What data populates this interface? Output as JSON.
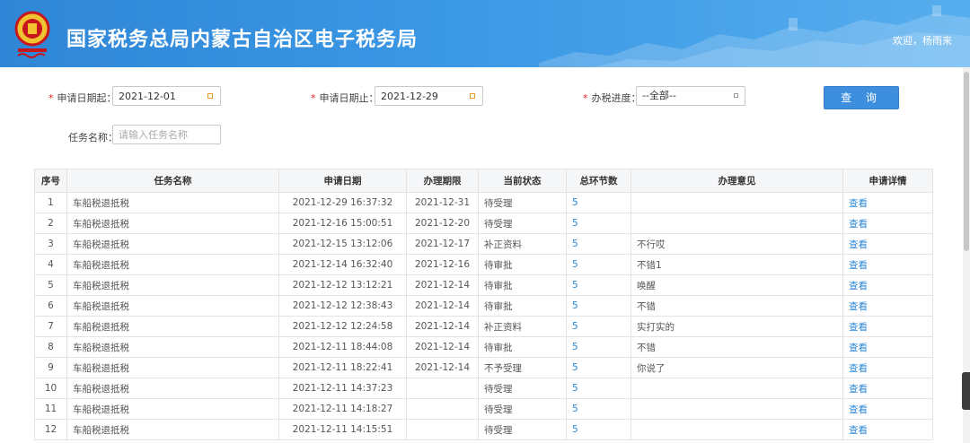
{
  "header": {
    "title": "国家税务总局内蒙古自治区电子税务局",
    "welcome": "欢迎，杨雨来",
    "logo_icon": "tax-emblem-icon",
    "colors": {
      "bar": "#3a97e4"
    }
  },
  "form": {
    "start_date_label": "申请日期起：",
    "start_date_value": "2021-12-01",
    "end_date_label": "申请日期止：",
    "end_date_value": "2021-12-29",
    "progress_label": "办税进度：",
    "progress_value": "--全部--",
    "task_label": "任务名称：",
    "task_placeholder": "请输入任务名称",
    "query_button": "查 询",
    "required_mark": "*"
  },
  "table": {
    "columns": [
      "序号",
      "任务名称",
      "申请日期",
      "办理期限",
      "当前状态",
      "总环节数",
      "办理意见",
      "申请详情"
    ],
    "rows": [
      [
        "1",
        "车船税退抵税",
        "2021-12-29 16:37:32",
        "2021-12-31",
        "待受理",
        "5",
        "",
        "查看"
      ],
      [
        "2",
        "车船税退抵税",
        "2021-12-16 15:00:51",
        "2021-12-20",
        "待受理",
        "5",
        "",
        "查看"
      ],
      [
        "3",
        "车船税退抵税",
        "2021-12-15 13:12:06",
        "2021-12-17",
        "补正资料",
        "5",
        "不行哎",
        "查看"
      ],
      [
        "4",
        "车船税退抵税",
        "2021-12-14 16:32:40",
        "2021-12-16",
        "待审批",
        "5",
        "不错1",
        "查看"
      ],
      [
        "5",
        "车船税退抵税",
        "2021-12-12 13:12:21",
        "2021-12-14",
        "待审批",
        "5",
        "唤醒",
        "查看"
      ],
      [
        "6",
        "车船税退抵税",
        "2021-12-12 12:38:43",
        "2021-12-14",
        "待审批",
        "5",
        "不错",
        "查看"
      ],
      [
        "7",
        "车船税退抵税",
        "2021-12-12 12:24:58",
        "2021-12-14",
        "补正资料",
        "5",
        "实打实的",
        "查看"
      ],
      [
        "8",
        "车船税退抵税",
        "2021-12-11 18:44:08",
        "2021-12-14",
        "待审批",
        "5",
        "不错",
        "查看"
      ],
      [
        "9",
        "车船税退抵税",
        "2021-12-11 18:22:41",
        "2021-12-14",
        "不予受理",
        "5",
        "你说了",
        "查看"
      ],
      [
        "10",
        "车船税退抵税",
        "2021-12-11 14:37:23",
        "",
        "待受理",
        "5",
        "",
        "查看"
      ],
      [
        "11",
        "车船税退抵税",
        "2021-12-11 14:18:27",
        "",
        "待受理",
        "5",
        "",
        "查看"
      ],
      [
        "12",
        "车船税退抵税",
        "2021-12-11 14:15:51",
        "",
        "待受理",
        "5",
        "",
        "查看"
      ]
    ]
  }
}
